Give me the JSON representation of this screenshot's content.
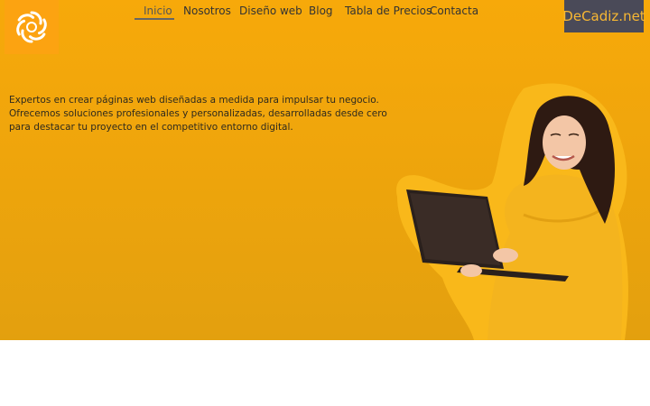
{
  "nav": {
    "items": [
      {
        "label": "Inicio",
        "active": true
      },
      {
        "label": "Nosotros"
      },
      {
        "label": "Diseño web"
      },
      {
        "label": "Blog"
      },
      {
        "label": "Tabla de Precios"
      },
      {
        "label": "Contacta"
      }
    ]
  },
  "brand": {
    "button_label": "DeCadiz.net"
  },
  "hero": {
    "tagline": "Expertos en crear páginas web diseñadas a medida para impulsar tu negocio. Ofrecemos soluciones profesionales y personalizadas, desarrolladas desde cero para destacar tu proyecto en el competitivo entorno digital.",
    "image": "woman-with-laptop-illustration"
  },
  "colors": {
    "hero_background": "#f2a60c",
    "logo_background": "#fca311",
    "brand_button_background": "#4a4a58",
    "brand_button_text": "#f7b733"
  },
  "icons": {
    "logo": "spiral-logo-icon"
  }
}
